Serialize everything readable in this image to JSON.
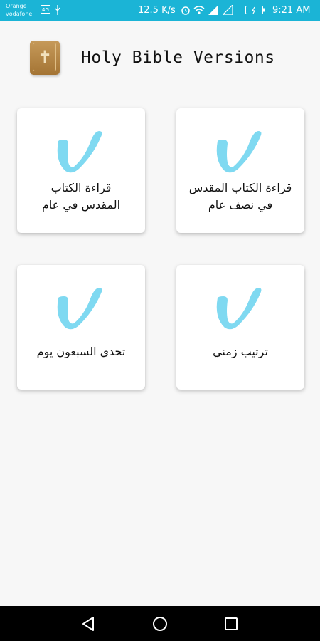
{
  "status_bar": {
    "carrier_line1": "Orange",
    "carrier_line2": "vodafone",
    "speed": "12.5 K/s",
    "time": "9:21 AM",
    "icons": [
      "volte-icon",
      "usb-icon",
      "alarm-icon",
      "wifi-icon",
      "signal-icon",
      "signal-icon",
      "battery-icon"
    ]
  },
  "header": {
    "title": "Holy Bible Versions",
    "logo_icon": "bible-book-icon"
  },
  "cards": [
    {
      "label_line1": "قراءة الكتاب",
      "label_line2": "المقدس في عام",
      "icon": "check-swoosh-icon"
    },
    {
      "label_line1": "قراءة الكتاب المقدس",
      "label_line2": "في نصف عام",
      "icon": "check-swoosh-icon"
    },
    {
      "label_line1": "تحدي السبعون يوم",
      "label_line2": "",
      "icon": "check-swoosh-icon"
    },
    {
      "label_line1": "ترتيب زمني",
      "label_line2": "",
      "icon": "check-swoosh-icon"
    }
  ],
  "nav_bar": {
    "buttons": [
      "back-icon",
      "home-icon",
      "recents-icon"
    ]
  },
  "colors": {
    "status_bar": "#1bb4d6",
    "background": "#f7f7f7",
    "swoosh": "#7fd9f1"
  }
}
